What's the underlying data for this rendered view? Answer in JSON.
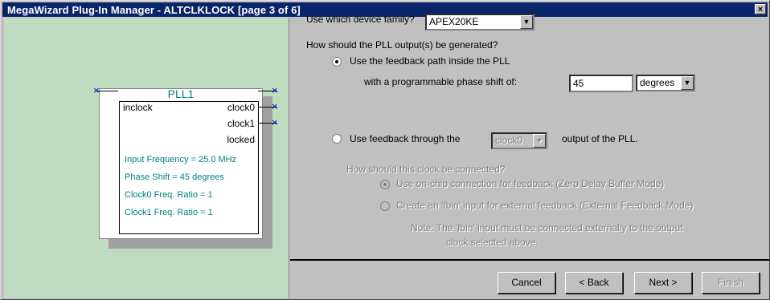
{
  "window": {
    "title": "MegaWizard Plug-In Manager - ALTCLKLOCK [page 3 of 6]",
    "close_glyph": "×"
  },
  "symbol": {
    "name": "PLL1",
    "inputs": [
      "inclock"
    ],
    "outputs": [
      "clock0",
      "clock1",
      "locked"
    ],
    "info": [
      "Input Frequency = 25.0 MHz",
      "Phase Shift = 45 degrees",
      "Clock0 Freq. Ratio = 1",
      "Clock1 Freq. Ratio = 1"
    ],
    "pin_marker": "×"
  },
  "form": {
    "family_question": "Use which device family?",
    "family_value": "APEX20KE",
    "output_question": "How should the PLL output(s) be generated?",
    "opt_internal": "Use the feedback path inside the PLL",
    "phase_label": "with a programmable phase shift of:",
    "phase_value": "45",
    "phase_unit": "degrees",
    "opt_external_pre": "Use feedback through the",
    "external_clock": "clock0",
    "opt_external_post": "output of the PLL.",
    "connect_question": "How should this clock be connected?",
    "opt_zero_delay": "Use on-chip connection for feedback (Zero Delay Buffer Mode)",
    "opt_fbin": "Create an 'fbin' input for external feedback (External Feedback Mode)",
    "note_line1": "Note:  The 'fbin' input must be connected externally to the output",
    "note_line2": "clock selected above.",
    "arrow_glyph": "▼"
  },
  "buttons": {
    "cancel": "Cancel",
    "back": "< Back",
    "next": "Next >",
    "finish": "Finish"
  }
}
